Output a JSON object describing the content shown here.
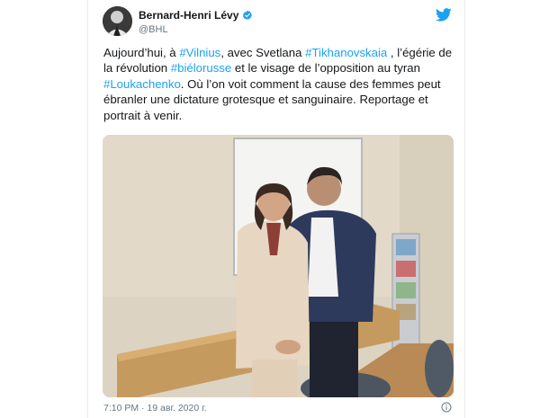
{
  "tweet": {
    "author_name": "Bernard-Henri Lévy",
    "author_handle": "@BHL",
    "text_segments": [
      {
        "text": "Aujourd’hui, à ",
        "kind": "plain"
      },
      {
        "text": "#Vilnius",
        "kind": "hashtag"
      },
      {
        "text": ", avec Svetlana ",
        "kind": "plain"
      },
      {
        "text": "#Tikhanovskaia",
        "kind": "hashtag"
      },
      {
        "text": " , l’égérie de la révolution ",
        "kind": "plain"
      },
      {
        "text": "#biélorusse",
        "kind": "hashtag"
      },
      {
        "text": " et le visage de l’opposition au tyran ",
        "kind": "plain"
      },
      {
        "text": "#Loukachenko",
        "kind": "hashtag"
      },
      {
        "text": ". Où l’on voit comment la cause des femmes peut ébranler une dictature grotesque et sanguinaire. Reportage et portrait à venir.",
        "kind": "plain"
      }
    ],
    "timestamp": "7:10 PM · 19 авг. 2020 г.",
    "photo_alt": "photo-woman-in-beige-suit-and-man-in-navy-jacket"
  },
  "icons": {
    "verified": "verified-badge-icon",
    "brand": "twitter-bird-icon",
    "info": "info-icon"
  },
  "colors": {
    "link": "#1da1f2",
    "text": "#14171a",
    "muted": "#657786",
    "verified": "#1da1f2"
  }
}
